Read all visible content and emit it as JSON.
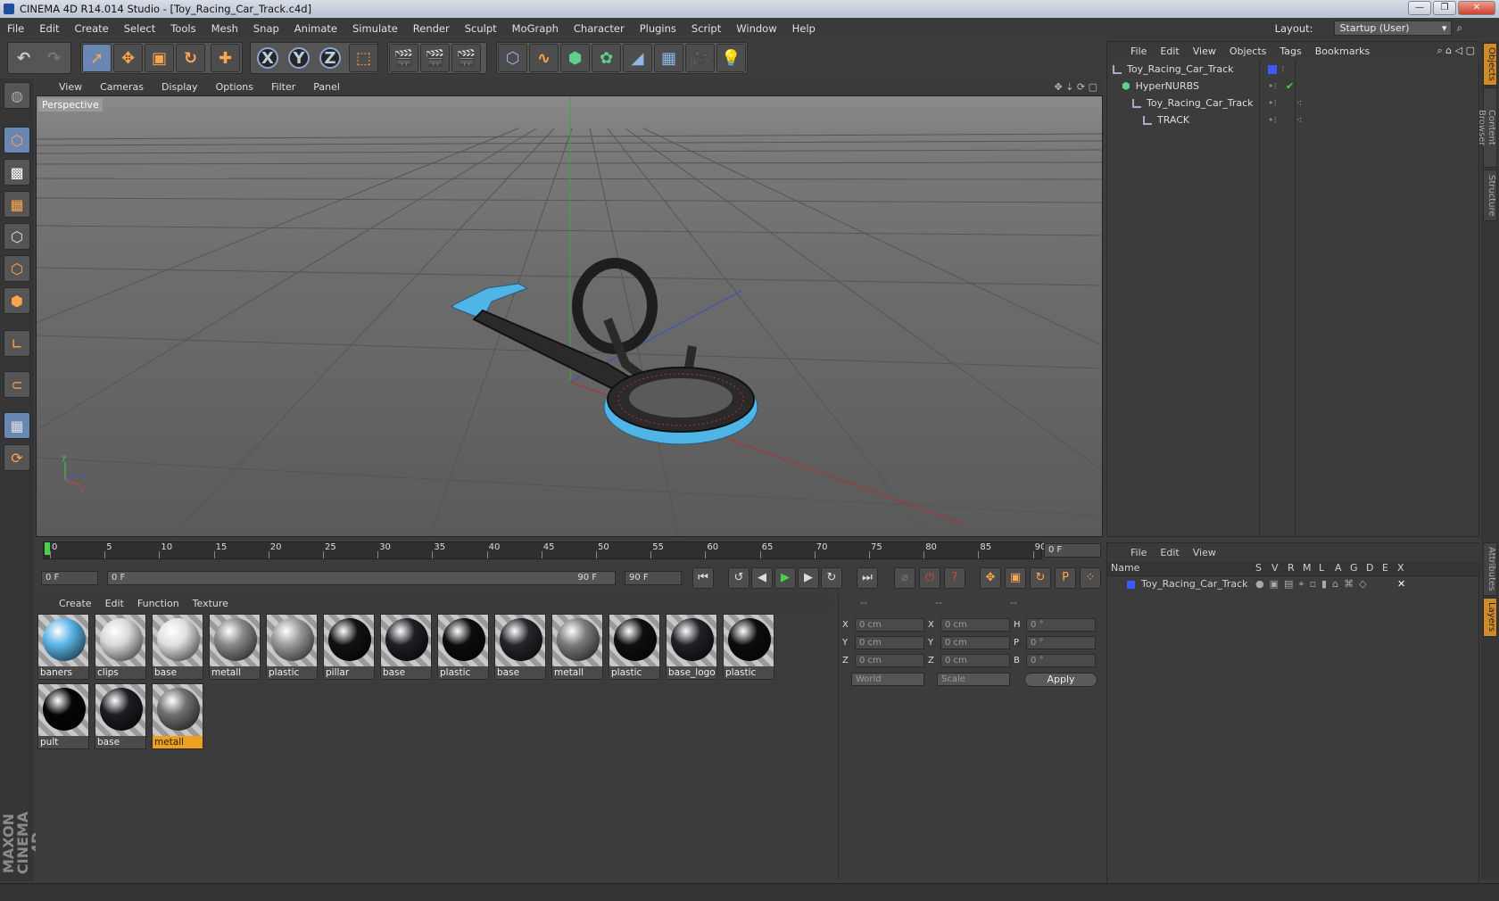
{
  "window": {
    "title": "CINEMA 4D R14.014 Studio - [Toy_Racing_Car_Track.c4d]"
  },
  "menu": [
    "File",
    "Edit",
    "Create",
    "Select",
    "Tools",
    "Mesh",
    "Snap",
    "Animate",
    "Simulate",
    "Render",
    "Sculpt",
    "MoGraph",
    "Character",
    "Plugins",
    "Script",
    "Window",
    "Help"
  ],
  "layout": {
    "label": "Layout:",
    "value": "Startup (User)"
  },
  "viewport": {
    "menu": [
      "View",
      "Cameras",
      "Display",
      "Options",
      "Filter",
      "Panel"
    ],
    "label": "Perspective"
  },
  "timeline": {
    "ticks": [
      "0",
      "5",
      "10",
      "15",
      "20",
      "25",
      "30",
      "35",
      "40",
      "45",
      "50",
      "55",
      "60",
      "65",
      "70",
      "75",
      "80",
      "85",
      "90"
    ],
    "current": "0 F"
  },
  "playbar": {
    "start": "0 F",
    "range_start": "0 F",
    "range_end": "90 F",
    "end": "90 F"
  },
  "materials": {
    "menu": [
      "Create",
      "Edit",
      "Function",
      "Texture"
    ],
    "items": [
      {
        "name": "baners",
        "color": "#5ab4e6",
        "selected": false
      },
      {
        "name": "clips",
        "color": "#d8d8d8",
        "selected": false
      },
      {
        "name": "base",
        "color": "#e0e0e0",
        "selected": false
      },
      {
        "name": "metall",
        "color": "#888888",
        "selected": false
      },
      {
        "name": "plastic",
        "color": "#9a9a9a",
        "selected": false
      },
      {
        "name": "pillar",
        "color": "#111111",
        "selected": false
      },
      {
        "name": "base",
        "color": "#1e1e24",
        "selected": false
      },
      {
        "name": "plastic",
        "color": "#0c0c0c",
        "selected": false
      },
      {
        "name": "base",
        "color": "#25252a",
        "selected": false
      },
      {
        "name": "metall",
        "color": "#7a7a7a",
        "selected": false
      },
      {
        "name": "plastic",
        "color": "#0e0e0e",
        "selected": false
      },
      {
        "name": "base_logo",
        "color": "#202026",
        "selected": false
      },
      {
        "name": "plastic",
        "color": "#0c0c0c",
        "selected": false
      },
      {
        "name": "pult",
        "color": "#050505",
        "selected": false
      },
      {
        "name": "base",
        "color": "#1c1c22",
        "selected": false
      },
      {
        "name": "metall",
        "color": "#6f6f6f",
        "selected": true
      }
    ]
  },
  "coords": {
    "headers": [
      "--",
      "--",
      "--"
    ],
    "rows": [
      {
        "a": "X",
        "av": "0 cm",
        "b": "X",
        "bv": "0 cm",
        "c": "H",
        "cv": "0 °"
      },
      {
        "a": "Y",
        "av": "0 cm",
        "b": "Y",
        "bv": "0 cm",
        "c": "P",
        "cv": "0 °"
      },
      {
        "a": "Z",
        "av": "0 cm",
        "b": "Z",
        "bv": "0 cm",
        "c": "B",
        "cv": "0 °"
      }
    ],
    "mode1": "World",
    "mode2": "Scale",
    "apply": "Apply"
  },
  "objects": {
    "menu": [
      "File",
      "Edit",
      "View",
      "Objects",
      "Tags",
      "Bookmarks"
    ],
    "rows": [
      {
        "name": "Toy_Racing_Car_Track",
        "indent": 0
      },
      {
        "name": "HyperNURBS",
        "indent": 1
      },
      {
        "name": "Toy_Racing_Car_Track",
        "indent": 2
      },
      {
        "name": "TRACK",
        "indent": 3
      }
    ]
  },
  "layers": {
    "menu": [
      "File",
      "Edit",
      "View"
    ],
    "columns": [
      "Name",
      "S",
      "V",
      "R",
      "M",
      "L",
      "A",
      "G",
      "D",
      "E",
      "X"
    ],
    "row": "Toy_Racing_Car_Track"
  },
  "side_tabs": [
    "Objects",
    "Content Browser",
    "Structure",
    "Attributes",
    "Layers"
  ],
  "brand": "MAXON CINEMA 4D"
}
